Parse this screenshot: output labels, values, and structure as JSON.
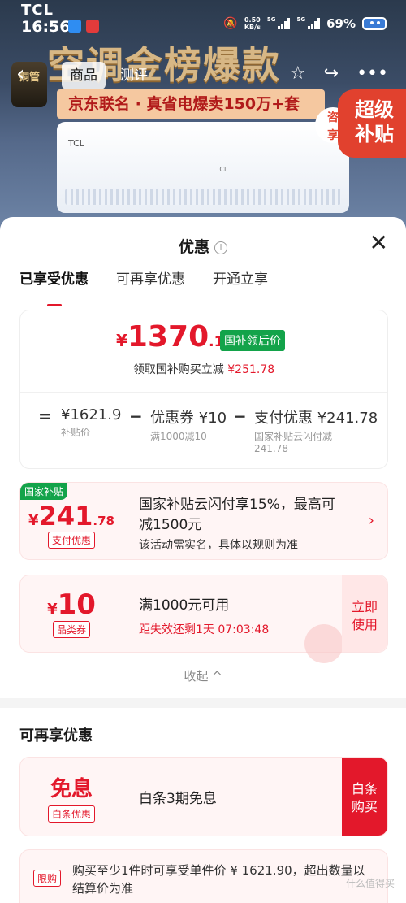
{
  "status": {
    "carrier": "TCL",
    "time": "16:56",
    "net_speed": "0.50\nKB/s",
    "sig1": "5G",
    "sig2": "5G",
    "battery": "69%"
  },
  "product": {
    "nav_goods": "商品",
    "nav_review": "测评",
    "banner_title": "空调金榜爆款",
    "banner_strip": "京东联名 · 真省电爆卖150万+套",
    "brand_small": "TCL",
    "badge": "超级\n补贴",
    "medal": "铜管"
  },
  "sheet": {
    "title": "优惠",
    "tabs": [
      "已享受优惠",
      "可再享优惠",
      "开通立享"
    ],
    "summary": {
      "currency": "¥",
      "price_int": "1370",
      "price_dec": ".12",
      "price_tag": "国补领后价",
      "desc_prefix": "领取国补购买立减",
      "desc_amount": "¥251.78",
      "eq": "=",
      "base": "¥1621.9",
      "base_label": "补贴价",
      "minus1": "−",
      "coupon": "优惠券 ¥10",
      "coupon_label": "满1000减10",
      "minus2": "−",
      "pay": "支付优惠 ¥241.78",
      "pay_label": "国家补贴云闪付减\n241.78"
    },
    "coupon1": {
      "corner": "国家补贴",
      "currency": "¥",
      "int": "241",
      "dec": ".78",
      "tag": "支付优惠",
      "line1": "国家补贴云闪付享15%，最高可",
      "line1b": "减1500元",
      "line2": "该活动需实名，具体以规则为准",
      "arrow": "›"
    },
    "coupon2": {
      "currency": "¥",
      "int": "10",
      "tag": "品类券",
      "line1": "满1000元可用",
      "line2": "距失效还剩1天 07:03:48",
      "btn": "立即\n使用"
    },
    "collapse": "收起 ^",
    "section2_title": "可再享优惠",
    "coupon3": {
      "big": "免息",
      "tag": "白条优惠",
      "line1": "白条3期免息",
      "btn": "白条\n购买"
    },
    "coupon4": {
      "tag": "限购",
      "text": "购买至少1件时可享受单件价 ¥ 1621.90，超出数量以结算价为准"
    },
    "watermark": "什么值得买"
  }
}
